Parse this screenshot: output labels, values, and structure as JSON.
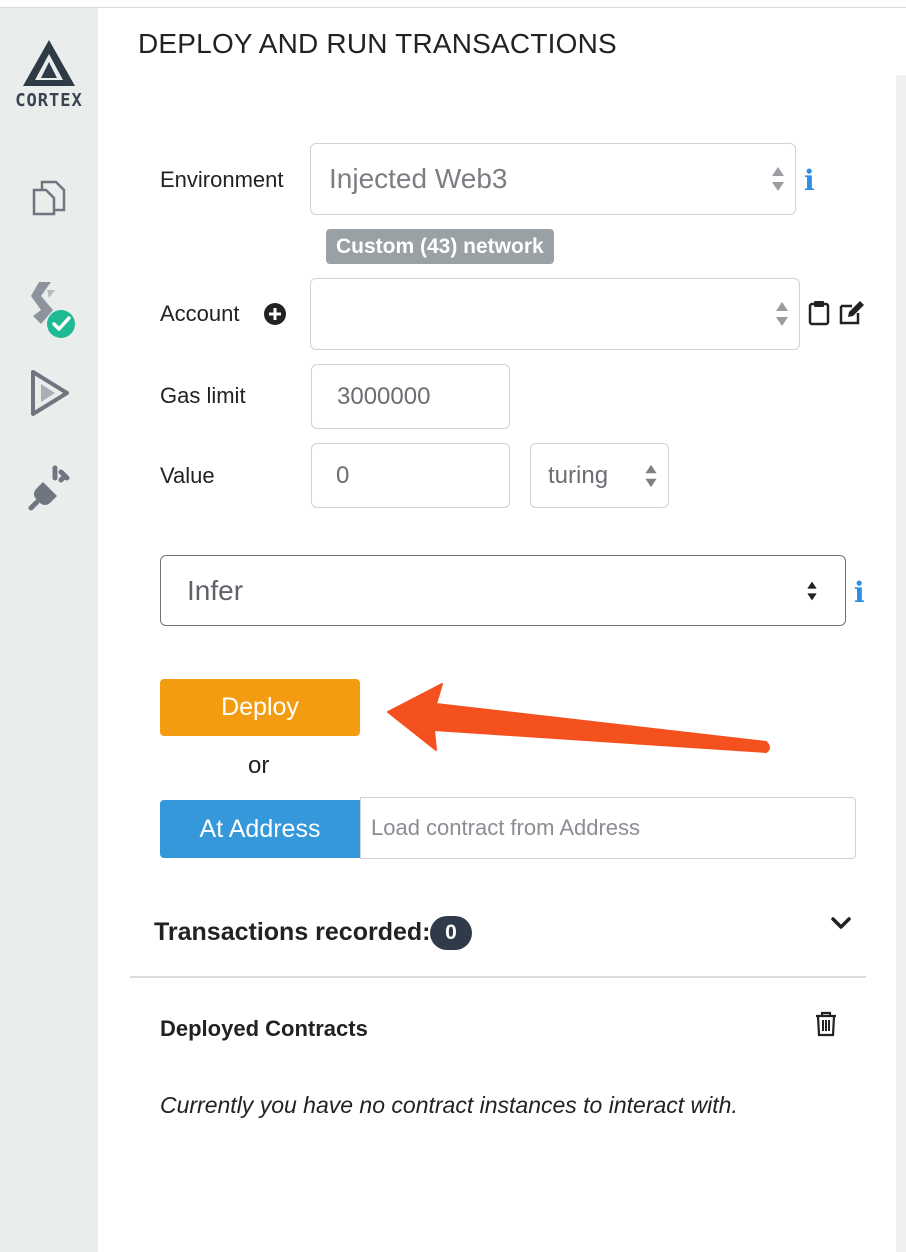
{
  "sidebar": {
    "logo_text": "CORTEX",
    "icons": [
      "file-explorer-icon",
      "compiler-icon",
      "deploy-run-icon",
      "plugin-manager-icon"
    ]
  },
  "panel": {
    "title": "DEPLOY AND RUN TRANSACTIONS",
    "environment": {
      "label": "Environment",
      "value": "Injected Web3",
      "network_badge": "Custom (43) network"
    },
    "account": {
      "label": "Account",
      "value": ""
    },
    "gas_limit": {
      "label": "Gas limit",
      "value": "3000000"
    },
    "value": {
      "label": "Value",
      "amount": "0",
      "unit": "turing"
    },
    "contract_select": "Infer",
    "deploy_label": "Deploy",
    "or_label": "or",
    "at_address_label": "At Address",
    "at_address_placeholder": "Load contract from Address",
    "transactions": {
      "label": "Transactions recorded:",
      "count": "0"
    },
    "deployed": {
      "label": "Deployed Contracts",
      "empty_message": "Currently you have no contract instances to interact with."
    }
  },
  "colors": {
    "deploy": "#f39c12",
    "at_address": "#3498db",
    "badge": "#9aa1a4",
    "info": "#2f8fe6",
    "arrow": "#f4511e"
  }
}
